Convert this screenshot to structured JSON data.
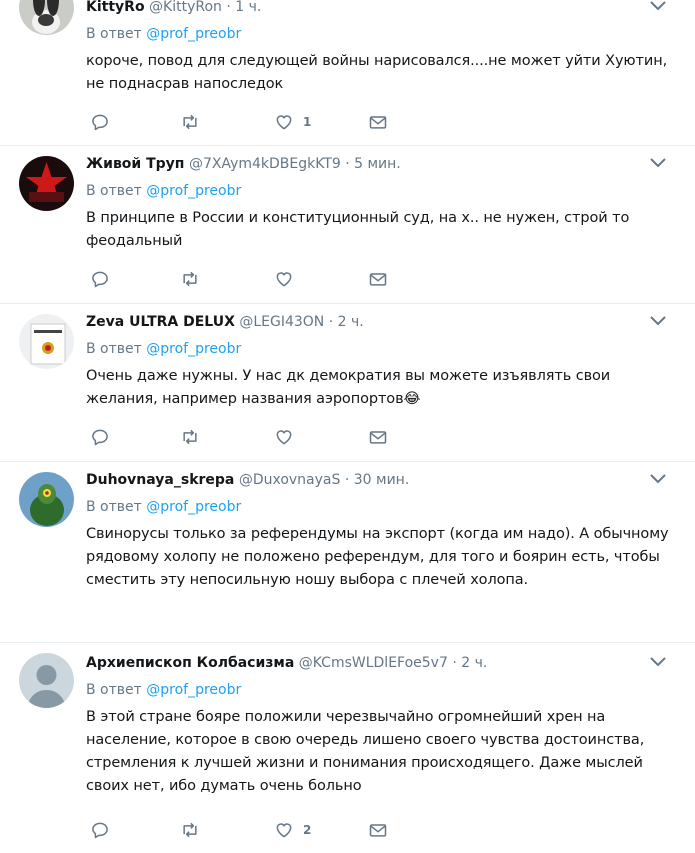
{
  "tweets": [
    {
      "name": "KittyRo",
      "handle": "@KittyRon",
      "time": "1 ч.",
      "reply_prefix": "В ответ",
      "reply_to": "@prof_preobr",
      "text": "короче, повод для следующей войны нарисовался....не может уйти Хуютин, не поднасрав напоследок",
      "like_count": "1",
      "avatar": "bunny-avatar"
    },
    {
      "name": "Живой Труп",
      "handle": "@7XAym4kDBEgkKT9",
      "time": "5 мин.",
      "reply_prefix": "В ответ",
      "reply_to": "@prof_preobr",
      "text": "В принципе в России и конституционный суд, на х.. не нужен, строй то феодальный",
      "like_count": "",
      "avatar": "red-star-avatar"
    },
    {
      "name": "Zeva ULTRA DELUX",
      "handle": "@LEGI43ON",
      "time": "2 ч.",
      "reply_prefix": "В ответ",
      "reply_to": "@prof_preobr",
      "text": "Очень даже нужны. У нас дк демократия вы можете изъявлять свои желания, например названия аэропортов😂",
      "like_count": "",
      "avatar": "constitution-book-avatar"
    },
    {
      "name": "Duhovnaya_skrepa",
      "handle": "@DuxovnayaS",
      "time": "30 мин.",
      "reply_prefix": "В ответ",
      "reply_to": "@prof_preobr",
      "text": "Свинорусы только за референдумы на экспорт (когда им надо). А обычному рядовому холопу не положено референдум, для того и боярин есть, чтобы сместить эту непосильную ношу выбора с плечей холопа.",
      "like_count": "",
      "avatar": "plankton-avatar"
    },
    {
      "name": "Архиепископ Колбасизма",
      "handle": "@KCmsWLDlEFoe5v7",
      "time": "2 ч.",
      "reply_prefix": "В ответ",
      "reply_to": "@prof_preobr",
      "text": "В этой стране бояре положили черезвычайно огромнейший хрен на население, которое в свою очередь лишено своего чувства достоинства, стремления к лучшей жизни и понимания происходящего. Даже мыслей своих нет, ибо думать очень больно",
      "like_count": "2",
      "avatar": "default-avatar"
    }
  ],
  "colors": {
    "link": "#1da1f2",
    "muted": "#657786",
    "text": "#14171a",
    "divider": "#e6ecf0"
  }
}
